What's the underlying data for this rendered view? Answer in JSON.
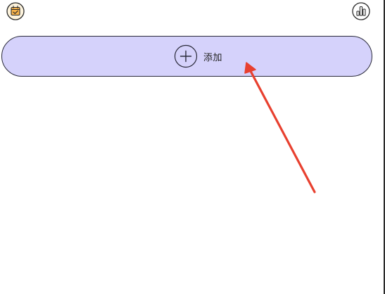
{
  "header": {
    "left_icon": "calendar-check-icon",
    "right_icon": "bar-chart-icon"
  },
  "add_button": {
    "label": "添加",
    "icon": "plus-circle-icon",
    "background": "#d5d2fb"
  },
  "annotation": {
    "arrow_color": "#e8402f"
  }
}
